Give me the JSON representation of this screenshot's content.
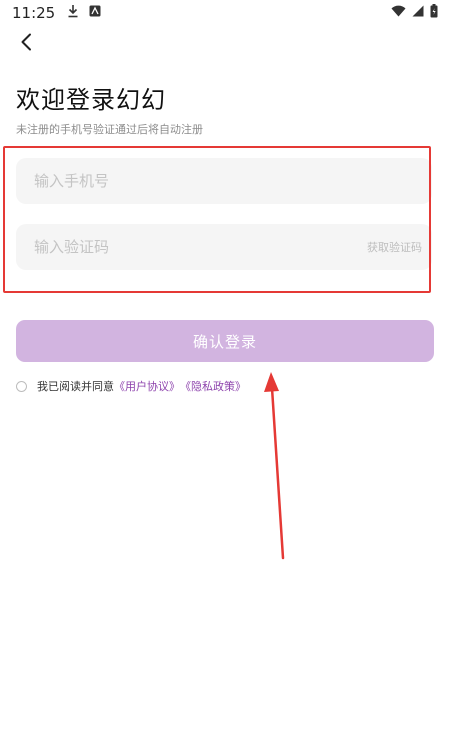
{
  "status_bar": {
    "time": "11:25"
  },
  "page": {
    "title": "欢迎登录幻幻",
    "subtitle": "未注册的手机号验证通过后将自动注册"
  },
  "form": {
    "phone_placeholder": "输入手机号",
    "code_placeholder": "输入验证码",
    "get_code_label": "获取验证码",
    "confirm_label": "确认登录"
  },
  "agreement": {
    "prefix": "我已阅读并同意",
    "user_agreement": "《用户协议》",
    "privacy_policy": "《隐私政策》"
  },
  "colors": {
    "accent": "#8e44ad",
    "button_bg": "#d2b4e0",
    "highlight": "#e53935"
  }
}
